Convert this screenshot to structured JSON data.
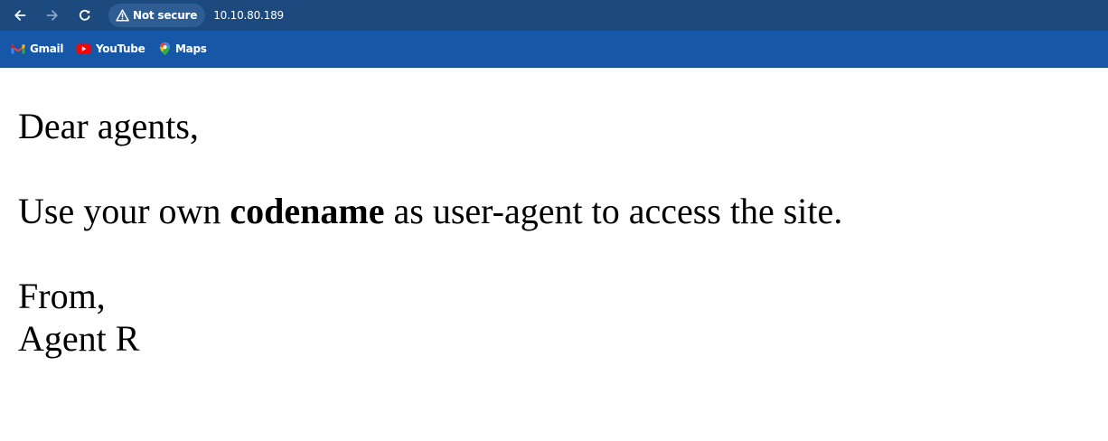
{
  "browser": {
    "security_label": "Not secure",
    "url": "10.10.80.189",
    "colors": {
      "toolbar_bg": "#1c4a7f",
      "bookmarks_bg": "#1757a8",
      "chip_bg": "#2d5d93"
    }
  },
  "nav": {
    "back_icon": "arrow-left-icon",
    "forward_icon": "arrow-right-icon",
    "reload_icon": "reload-icon"
  },
  "bookmarks": [
    {
      "label": "Gmail",
      "icon": "gmail-icon"
    },
    {
      "label": "YouTube",
      "icon": "youtube-icon"
    },
    {
      "label": "Maps",
      "icon": "maps-icon"
    }
  ],
  "page": {
    "greeting": "Dear agents,",
    "instruction_before": "Use your own ",
    "instruction_bold": "codename",
    "instruction_after": " as user-agent to access the site.",
    "closing": "From,",
    "signature": "Agent R"
  }
}
